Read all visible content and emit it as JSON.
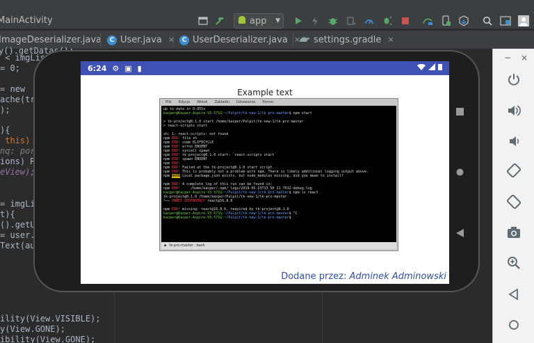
{
  "ide": {
    "window_title": "MainActivity",
    "run_config": "app",
    "tabs": [
      {
        "label": "ImageDeserializer.java"
      },
      {
        "label": "User.java"
      },
      {
        "label": "UserDeserializer.java"
      },
      {
        "label": "settings.gradle"
      }
    ]
  },
  "code_lines": [
    "y().getDatas();",
    " < imgLis",
    "= 0;",
    "",
    "= new",
    "ache(tr",
    ");",
    "",
    "){",
    " this)",
    "nq: port",
    "ions) R",
    "eView);",
    "",
    "",
    "= imgLi",
    "t){",
    "().getU",
    "= user.",
    "Text(au",
    "",
    "",
    "",
    "",
    "ility(View.VISIBLE);",
    "y(View.GONE);",
    "ibility(View.GONE);"
  ],
  "phone": {
    "time": "6:24",
    "app_title": "Example text",
    "caption_prefix": "Dodane przez:",
    "caption_author": "Adminek Adminowski",
    "terminal": {
      "menu": [
        "Plik",
        "Edycja",
        "Widok",
        "Zakładki",
        "Ustawienia",
        "Pomoc"
      ],
      "lines": [
        "up to date in 8.855s",
        "kacper@Kacper-Aspire-V3-571G:~/Pulpit/tk-new-1/tk-pro-master$ npm start",
        "",
        "> tk-project@0.1.0 start /home/kacper/Pulpit/tk-new-1/tk-pro-master",
        "> react-scripts start",
        "",
        "sh: 1: react-scripts: not found",
        "npm ERR! file sh",
        "npm ERR! code ELIFECYCLE",
        "npm ERR! errno ENOENT",
        "npm ERR! syscall spawn",
        "npm ERR! tk-project@0.1.0 start: `react-scripts start`",
        "npm ERR! spawn ENOENT",
        "npm ERR!",
        "npm ERR! Failed at the tk-project@0.1.0 start script.",
        "npm ERR! This is probably not a problem with npm. There is likely additional logging output above.",
        "npm WARN Local package.json exists, but node_modules missing, did you mean to install?",
        "",
        "npm ERR! A complete log of this run can be found in:",
        "npm ERR!     /home/kacper/.npm/_logs/2019-05-23T13_50_21_751Z-debug.log",
        "kacper@Kacper-Aspire-V3-571G:~/Pulpit/tk-new-1/tk-pro-master$ npm ls react",
        "tk-project@0.1.0 /home/kacper/Pulpit/tk-new-1/tk-pro-master",
        "└── UNMET DEPENDENCY react@16.8.6",
        "",
        "npm ERR! missing: react@16.8.6, required by tk-project@0.1.0",
        "kacper@Kacper-Aspire-V3-571G:~/Pulpit/tk-new-1/tk-pro-master$ ^C",
        "kacper@Kacper-Aspire-V3-571G:~/Pulpit/tk-new-1/tk-pro-master$ "
      ],
      "tab_label": "tk-pro-master : bash"
    }
  },
  "emulator": {
    "close": "×",
    "minimize": "−"
  }
}
